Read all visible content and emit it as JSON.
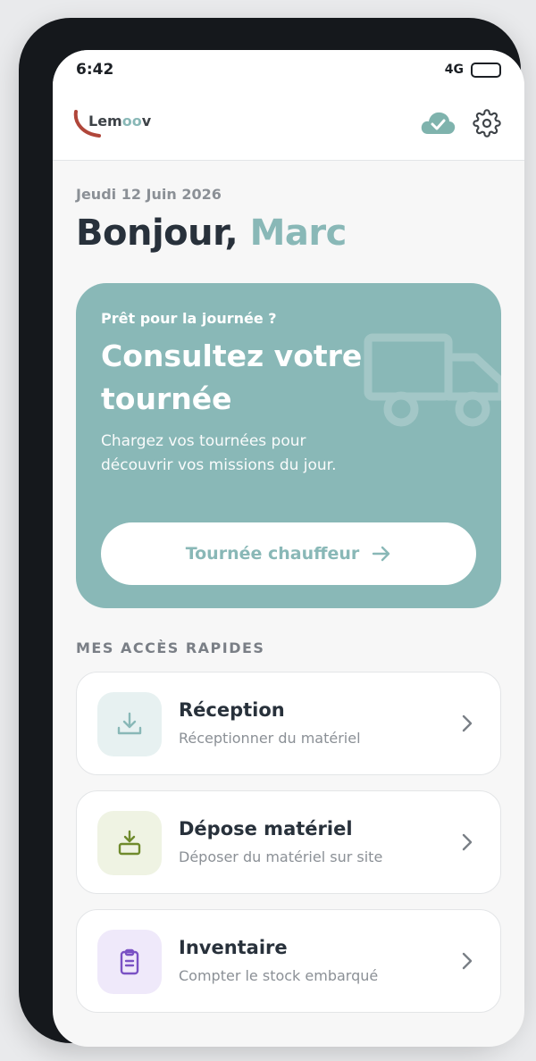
{
  "status_bar": {
    "time": "6:42",
    "network": "4G"
  },
  "app_bar": {
    "logo_text_prefix": "Lem",
    "logo_text_accent": "oo",
    "logo_text_suffix": "v",
    "sync_icon": "cloud-check-icon",
    "settings_icon": "gear-icon"
  },
  "header": {
    "date": "Jeudi 12 Juin 2026",
    "greeting": "Bonjour,",
    "name": "Marc"
  },
  "hero": {
    "kicker": "Prêt pour la journée ?",
    "title": "Consultez votre tournée",
    "description": "Chargez vos tournées pour découvrir vos missions du jour.",
    "button_label": "Tournée chauffeur",
    "icon": "truck-icon"
  },
  "quick_access": {
    "title": "MES ACCÈS RAPIDES",
    "items": [
      {
        "title": "Réception",
        "subtitle": "Réceptionner du matériel",
        "icon": "download-tray-icon",
        "icon_bg": "#e7f1f1",
        "icon_color": "#89b8b7"
      },
      {
        "title": "Dépose matériel",
        "subtitle": "Déposer du matériel sur site",
        "icon": "drop-box-icon",
        "icon_bg": "#eff3e3",
        "icon_color": "#6f8a2c"
      },
      {
        "title": "Inventaire",
        "subtitle": "Compter le stock embarqué",
        "icon": "clipboard-icon",
        "icon_bg": "#efe9fa",
        "icon_color": "#7a52c4"
      }
    ]
  },
  "colors": {
    "accent": "#89b8b7",
    "text_dark": "#28313b",
    "text_muted": "#8b9096",
    "phone_frame": "#15181c"
  }
}
